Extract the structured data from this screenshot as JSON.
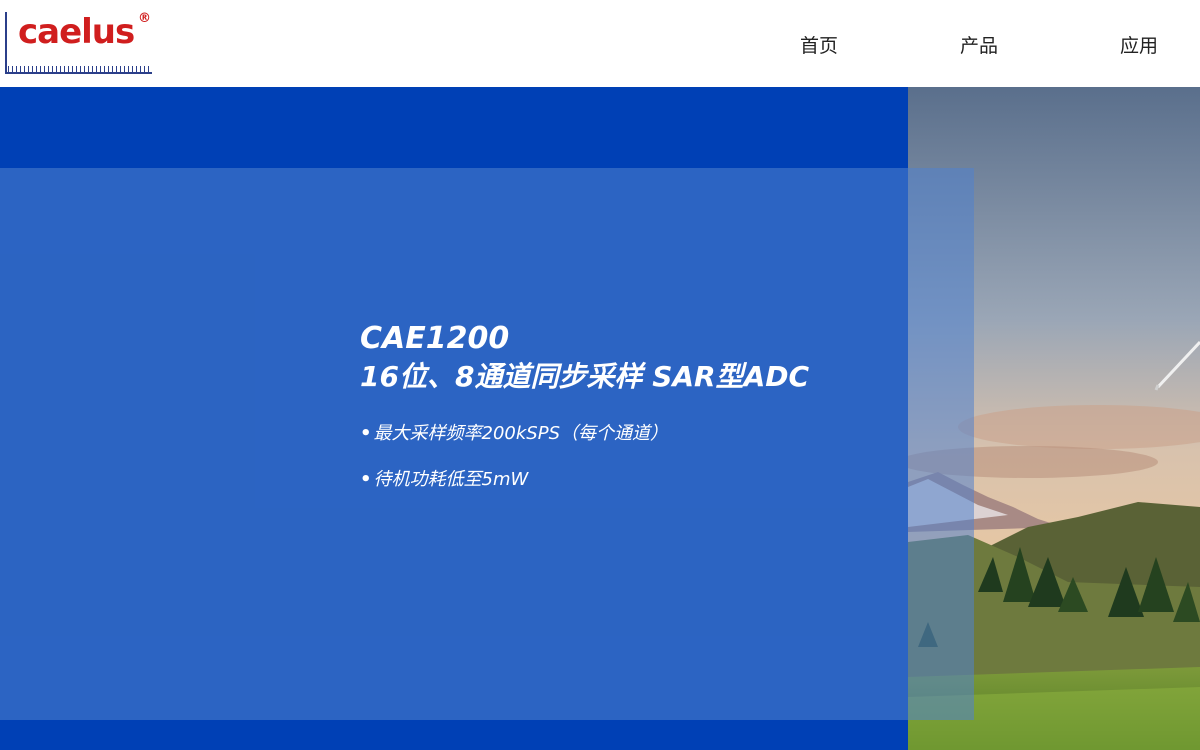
{
  "header": {
    "logo_text": "caelus",
    "logo_reg": "®",
    "nav": [
      {
        "label": "首页"
      },
      {
        "label": "产品"
      },
      {
        "label": "应用"
      }
    ]
  },
  "hero": {
    "model": "CAE1200",
    "subtitle": "16位、8通道同步采样 SAR型ADC",
    "features": [
      {
        "bullet": "•",
        "text": "最大采样频率200kSPS（每个通道）"
      },
      {
        "bullet": "•",
        "text": "待机功耗低至5mW"
      }
    ]
  },
  "colors": {
    "brand_red": "#d01e1e",
    "brand_navy": "#2b3f8a",
    "hero_blue": "#0040b5",
    "overlay_blue": "#5082cd"
  },
  "icons": {
    "logo": "caelus-logo",
    "photo": "wind-turbine-landscape"
  }
}
